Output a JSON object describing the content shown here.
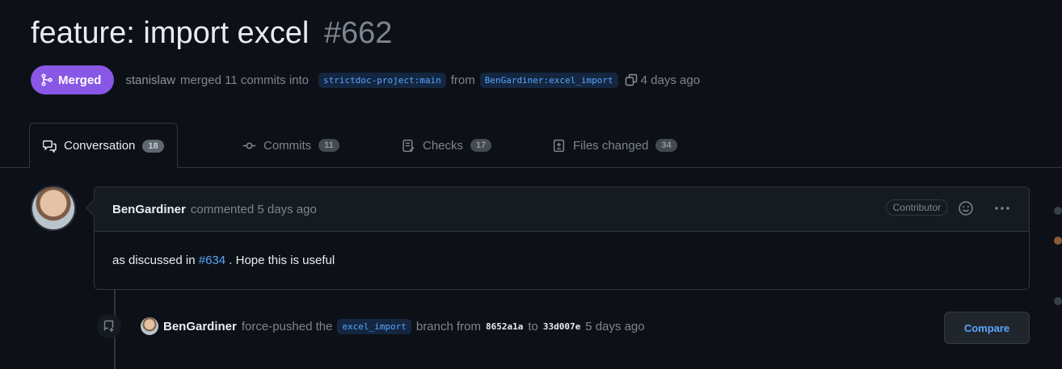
{
  "pr": {
    "title": "feature: import excel",
    "number": "#662",
    "status": "Merged",
    "merger": "stanislaw",
    "merge_text": "merged 11 commits into",
    "base_branch": "strictdoc-project:main",
    "from_text": "from",
    "head_branch": "BenGardiner:excel_import",
    "time": "4 days ago"
  },
  "tabs": [
    {
      "label": "Conversation",
      "count": "18",
      "icon": "comment-discussion-icon"
    },
    {
      "label": "Commits",
      "count": "11",
      "icon": "git-commit-icon"
    },
    {
      "label": "Checks",
      "count": "17",
      "icon": "checklist-icon"
    },
    {
      "label": "Files changed",
      "count": "34",
      "icon": "file-diff-icon"
    }
  ],
  "comment": {
    "author": "BenGardiner",
    "meta": "commented 5 days ago",
    "role": "Contributor",
    "body_prefix": "as discussed in",
    "body_link": "#634",
    "body_suffix": ". Hope this is useful"
  },
  "event": {
    "user": "BenGardiner",
    "text1": "force-pushed the",
    "branch": "excel_import",
    "text2": "branch from",
    "from_sha": "8652a1a",
    "to_text": "to",
    "to_sha": "33d007e",
    "time": "5 days ago",
    "button": "Compare"
  },
  "colors": {
    "merged": "#8957e5",
    "link": "#58a6ff",
    "background": "#0d1117"
  }
}
